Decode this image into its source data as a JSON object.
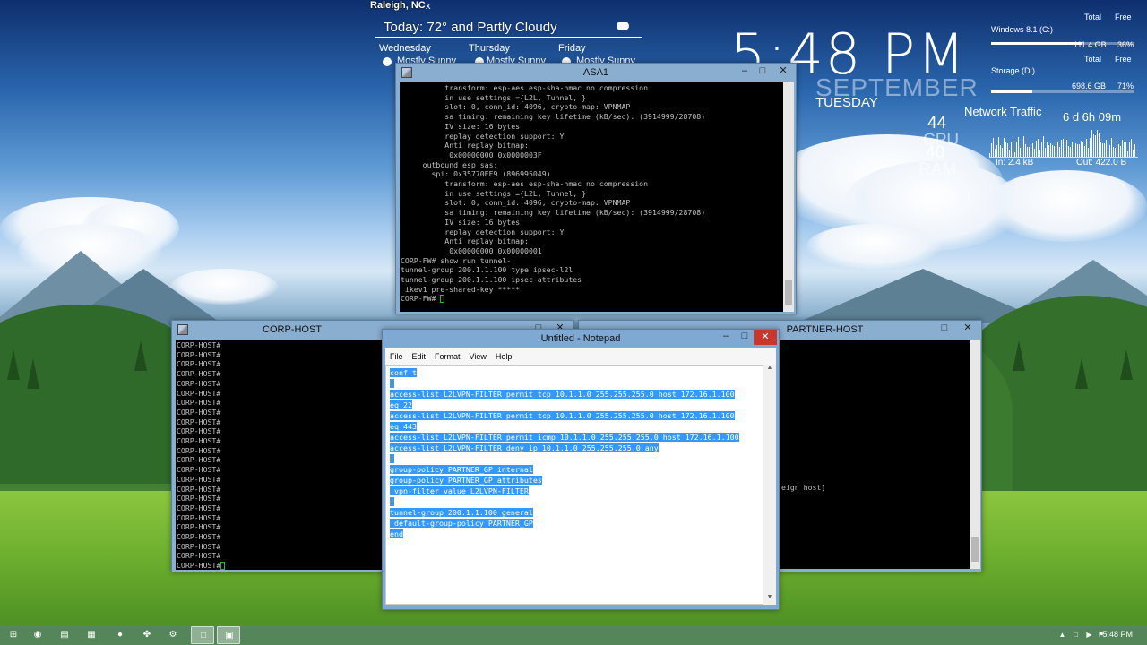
{
  "weather": {
    "city": "Raleigh, NC",
    "close": "x",
    "today": "Today:  72° and Partly Cloudy",
    "forecast": [
      {
        "day": "Wednesday",
        "condition": "Mostly Sunny"
      },
      {
        "day": "Thursday",
        "condition": "Mostly Sunny"
      },
      {
        "day": "Friday",
        "condition": "Mostly Sunny"
      }
    ]
  },
  "clock": {
    "time": "5:48 PM",
    "month": "SEPTEMBER",
    "weekday": "TUESDAY"
  },
  "disks": {
    "col_total": "Total",
    "col_free": "Free",
    "items": [
      {
        "label": "Windows 8.1 (C:)",
        "total": "111.4 GB",
        "free": "36%",
        "used_fraction": 0.64
      },
      {
        "label": "Storage (D:)",
        "total": "698.6 GB",
        "free": "71%",
        "used_fraction": 0.29
      }
    ]
  },
  "system": {
    "cpu_value": "44",
    "cpu_label": "CPU",
    "ram_value": "40",
    "ram_label": "RAM",
    "network_title": "Network Traffic",
    "uptime": "6 d 6h 09m",
    "net_in": "In: 2.4 kB",
    "net_out": "Out: 422.0 B"
  },
  "asa_window": {
    "title": "ASA1",
    "lines": [
      "          transform: esp-aes esp-sha-hmac no compression",
      "          in use settings ={L2L, Tunnel, }",
      "          slot: 0, conn_id: 4096, crypto-map: VPNMAP",
      "          sa timing: remaining key lifetime (kB/sec): (3914999/28708)",
      "          IV size: 16 bytes",
      "          replay detection support: Y",
      "          Anti replay bitmap:",
      "           0x00000000 0x0000003F",
      "     outbound esp sas:",
      "       spi: 0x35770EE9 (896995049)",
      "          transform: esp-aes esp-sha-hmac no compression",
      "          in use settings ={L2L, Tunnel, }",
      "          slot: 0, conn_id: 4096, crypto-map: VPNMAP",
      "          sa timing: remaining key lifetime (kB/sec): (3914999/28708)",
      "          IV size: 16 bytes",
      "          replay detection support: Y",
      "          Anti replay bitmap:",
      "           0x00000000 0x00000001",
      "",
      "CORP-FW# show run tunnel-",
      "tunnel-group 200.1.1.100 type ipsec-l2l",
      "tunnel-group 200.1.1.100 ipsec-attributes",
      " ikev1 pre-shared-key *****",
      "CORP-FW# "
    ]
  },
  "corp_host_window": {
    "title": "CORP-HOST",
    "prompt_line": "CORP-HOST#",
    "line_count": 24
  },
  "partner_host_window": {
    "title": "PARTNER-HOST",
    "visible_text": "eign host]"
  },
  "notepad": {
    "title": "Untitled - Notepad",
    "menu": [
      "File",
      "Edit",
      "Format",
      "View",
      "Help"
    ],
    "lines": [
      "conf t",
      "!",
      "access-list L2LVPN-FILTER permit tcp 10.1.1.0 255.255.255.0 host 172.16.1.100",
      "eq 22",
      "access-list L2LVPN-FILTER permit tcp 10.1.1.0 255.255.255.0 host 172.16.1.100",
      "eq 443",
      "access-list L2LVPN-FILTER permit icmp 10.1.1.0 255.255.255.0 host 172.16.1.100",
      "access-list L2LVPN-FILTER deny ip 10.1.1.0 255.255.255.0 any",
      "!",
      "group-policy PARTNER_GP internal",
      "group-policy PARTNER_GP attributes",
      " vpn-filter value L2LVPN-FILTER",
      "!",
      "tunnel-group 200.1.1.100 general",
      " default-group-policy PARTNER_GP",
      "end"
    ]
  },
  "taskbar": {
    "items": [
      {
        "icon": "start-icon",
        "glyph": "⊞"
      },
      {
        "icon": "firefox-icon",
        "glyph": "◉"
      },
      {
        "icon": "file-explorer-icon",
        "glyph": "▤"
      },
      {
        "icon": "calculator-icon",
        "glyph": "▦"
      },
      {
        "icon": "spotify-icon",
        "glyph": "●"
      },
      {
        "icon": "gns3-icon",
        "glyph": "✤"
      },
      {
        "icon": "putty-icon",
        "glyph": "⚙"
      },
      {
        "icon": "notepad-icon",
        "glyph": "□"
      },
      {
        "icon": "console-icon",
        "glyph": "▣"
      }
    ],
    "time": "5:48 PM"
  }
}
